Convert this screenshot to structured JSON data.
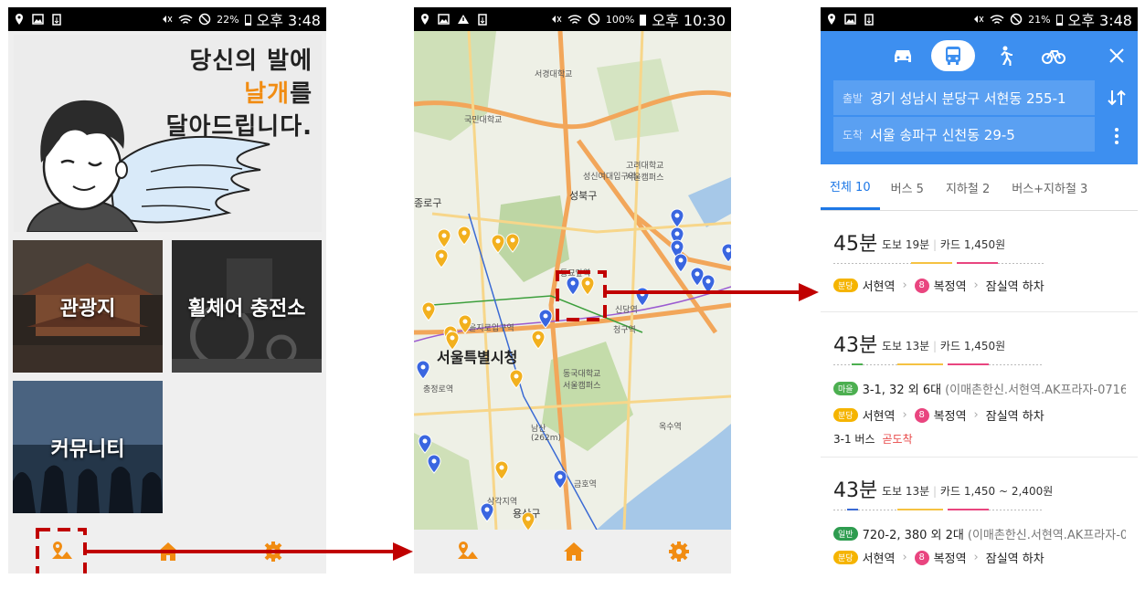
{
  "phone1": {
    "status": {
      "pct": "22%",
      "time": "오후 3:48"
    },
    "banner": {
      "line1": "당신의 발에",
      "line2_highlight": "날개",
      "line2_rest": "를",
      "line3": "달아드립니다."
    },
    "tiles": {
      "tourism": "관광지",
      "wheelchair": "휠체어 충전소",
      "community": "커뮤니티"
    },
    "nav": [
      "map-icon",
      "home-icon",
      "gear-icon"
    ]
  },
  "phone2": {
    "status": {
      "pct": "100%",
      "time": "오후 10:30"
    },
    "map_labels": {
      "cityhall": "서울특별시청",
      "seongbuk": "성북구",
      "jongno": "종로구",
      "yongsan": "용산구",
      "namsan": "남산 (262m)",
      "univ1": "서경대학교",
      "univ2": "국민대학교",
      "univ3": "고려대학교 서울캠퍼스",
      "univ4": "성신여대입구역",
      "univ5": "동국대학교 서울캠퍼스",
      "st1": "동묘앞역",
      "st2": "신당역",
      "st3": "청구역",
      "st4": "충정로역",
      "st5": "삼각지역",
      "st6": "옥수역",
      "st7": "금호역",
      "st8": "을지로입구역"
    },
    "nav": [
      "map-icon",
      "home-icon",
      "gear-icon"
    ]
  },
  "phone3": {
    "status": {
      "pct": "21%",
      "time": "오후 3:48"
    },
    "from_label": "출발",
    "from": "경기 성남시 분당구 서현동 255-1",
    "to_label": "도착",
    "to": "서울 송파구 신천동 29-5",
    "tabs": [
      "전체 10",
      "버스 5",
      "지하철 2",
      "버스+지하철 3"
    ],
    "routes": [
      {
        "dur": "45분",
        "walk": "도보 19분",
        "fare": "카드 1,450원",
        "badge": "분당",
        "s1": "서현역",
        "num": "8",
        "s2": "복정역",
        "s3": "잠실역 하차"
      },
      {
        "dur": "43분",
        "walk": "도보 13분",
        "fare": "카드 1,450원",
        "bus_badge": "마을",
        "bus": "3-1, 32 외 6대",
        "bus_sub": "(이매촌한신.서현역.AK프라자-0716...",
        "badge": "분당",
        "s1": "서현역",
        "num": "8",
        "s2": "복정역",
        "s3": "잠실역 하차",
        "note": "3-1 버스",
        "note_red": "곧도착"
      },
      {
        "dur": "43분",
        "walk": "도보 13분",
        "fare": "카드 1,450 ~ 2,400원",
        "bus_badge": "일반",
        "bus": "720-2, 380 외 2대",
        "bus_sub": "(이매촌한신.서현역.AK프라자-0...",
        "badge": "분당",
        "s1": "서현역",
        "num": "8",
        "s2": "복정역",
        "s3": "잠실역 하차"
      }
    ]
  },
  "colors": {
    "accent_orange": "#f18c12",
    "header_blue": "#3d8ff0",
    "arrow_red": "#c00000",
    "line_pink": "#e9457f",
    "line_yellow": "#f5c242"
  }
}
